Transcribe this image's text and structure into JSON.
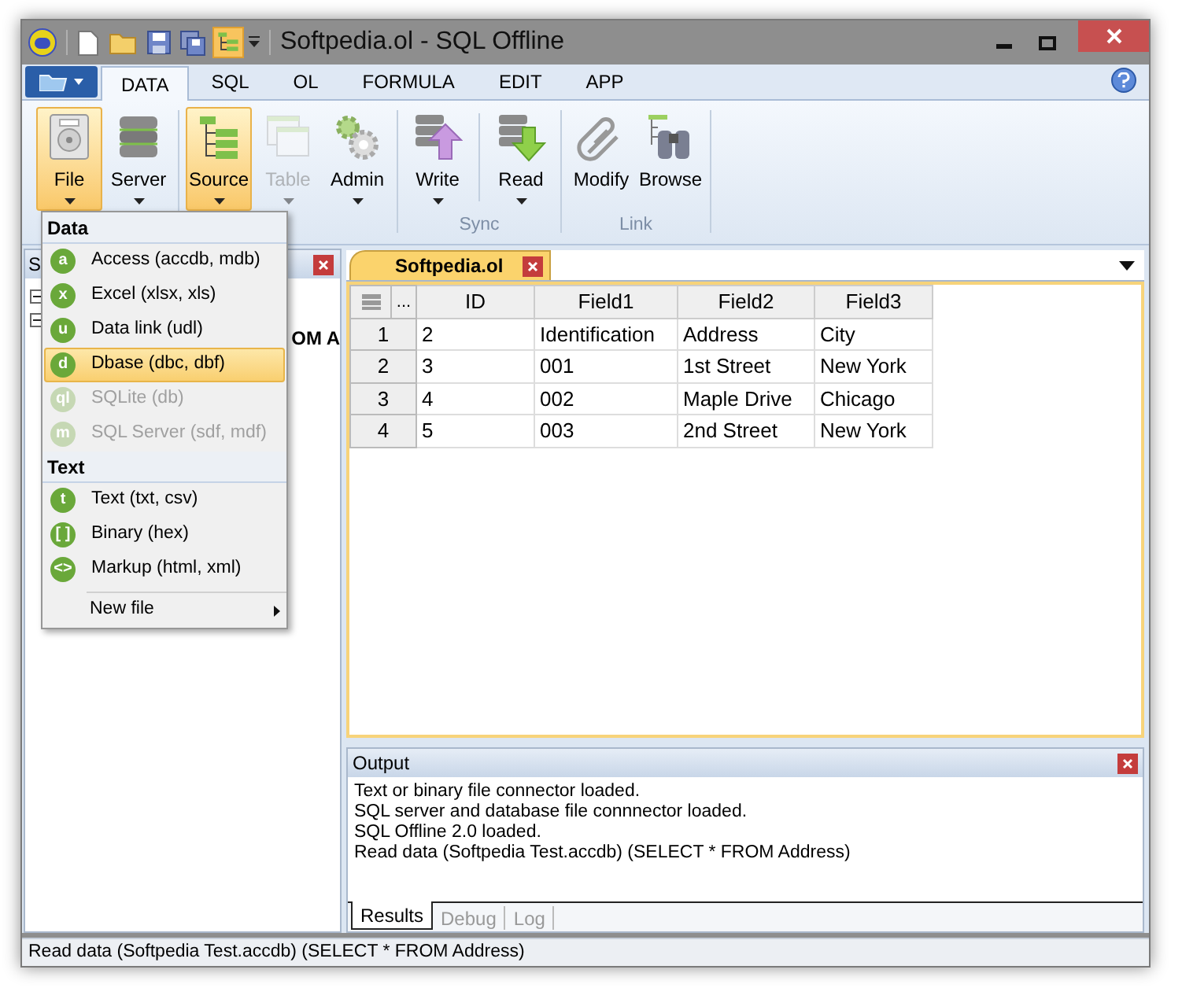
{
  "window": {
    "title": "Softpedia.ol - SQL Offline"
  },
  "ribbon_tabs": [
    {
      "label": "DATA",
      "selected": true
    },
    {
      "label": "SQL",
      "selected": false
    },
    {
      "label": "OL",
      "selected": false
    },
    {
      "label": "FORMULA",
      "selected": false
    },
    {
      "label": "EDIT",
      "selected": false
    },
    {
      "label": "APP",
      "selected": false
    }
  ],
  "ribbon_groups": [
    {
      "buttons": [
        {
          "label": "File",
          "selected": true,
          "disabled": false,
          "dropdown": true
        },
        {
          "label": "Server",
          "selected": false,
          "disabled": false,
          "dropdown": true
        }
      ]
    },
    {
      "buttons": [
        {
          "label": "Source",
          "selected": true,
          "disabled": false,
          "dropdown": true
        },
        {
          "label": "Table",
          "selected": false,
          "disabled": true,
          "dropdown": true
        },
        {
          "label": "Admin",
          "selected": false,
          "disabled": false,
          "dropdown": true
        }
      ]
    },
    {
      "label": "Sync",
      "buttons": [
        {
          "label": "Write",
          "selected": false,
          "disabled": false,
          "dropdown": true
        },
        {
          "label": "Read",
          "selected": false,
          "disabled": false,
          "dropdown": true
        }
      ]
    },
    {
      "label": "Link",
      "buttons": [
        {
          "label": "Modify",
          "selected": false,
          "disabled": false,
          "dropdown": false
        },
        {
          "label": "Browse",
          "selected": false,
          "disabled": false,
          "dropdown": false
        }
      ]
    }
  ],
  "file_menu": {
    "sections": [
      {
        "heading": "Data",
        "items": [
          {
            "glyph": "a",
            "label": "Access (accdb, mdb)",
            "selected": false,
            "disabled": false
          },
          {
            "glyph": "x",
            "label": "Excel (xlsx, xls)",
            "selected": false,
            "disabled": false
          },
          {
            "glyph": "u",
            "label": "Data link (udl)",
            "selected": false,
            "disabled": false
          },
          {
            "glyph": "d",
            "label": "Dbase (dbc, dbf)",
            "selected": true,
            "disabled": false
          },
          {
            "glyph": "ql",
            "label": "SQLite (db)",
            "selected": false,
            "disabled": true
          },
          {
            "glyph": "m",
            "label": "SQL Server (sdf, mdf)",
            "selected": false,
            "disabled": true
          }
        ]
      },
      {
        "heading": "Text",
        "items": [
          {
            "glyph": "t",
            "label": "Text (txt, csv)",
            "selected": false,
            "disabled": false
          },
          {
            "glyph": "[ ]",
            "label": "Binary (hex)",
            "selected": false,
            "disabled": false
          },
          {
            "glyph": "<>",
            "label": "Markup (html, xml)",
            "selected": false,
            "disabled": false
          }
        ]
      }
    ],
    "footer": {
      "label": "New file",
      "submenu": true
    }
  },
  "left_panel": {
    "title": "S",
    "lines": [
      "OM A"
    ]
  },
  "document": {
    "tabs": [
      {
        "label": "Softpedia.ol",
        "selected": true
      }
    ],
    "corner": "...",
    "columns": [
      "ID",
      "Field1",
      "Field2",
      "Field3"
    ],
    "rows": [
      {
        "header": "1",
        "cells": [
          "2",
          "Identification",
          "Address",
          "City"
        ]
      },
      {
        "header": "2",
        "cells": [
          "3",
          "001",
          "1st Street",
          "New York"
        ]
      },
      {
        "header": "3",
        "cells": [
          "4",
          "002",
          "Maple Drive",
          "Chicago"
        ]
      },
      {
        "header": "4",
        "cells": [
          "5",
          "003",
          "2nd Street",
          "New York"
        ]
      }
    ]
  },
  "output": {
    "title": "Output",
    "lines": [
      "Text or binary file connector loaded.",
      "SQL server and database file connnector loaded.",
      "SQL Offline 2.0 loaded.",
      "Read data (Softpedia Test.accdb) (SELECT * FROM Address)"
    ],
    "tabs": [
      {
        "label": "Results",
        "selected": true
      },
      {
        "label": "Debug",
        "selected": false
      },
      {
        "label": "Log",
        "selected": false
      }
    ]
  },
  "status_bar": {
    "text": "Read data (Softpedia Test.accdb) (SELECT * FROM Address)"
  }
}
